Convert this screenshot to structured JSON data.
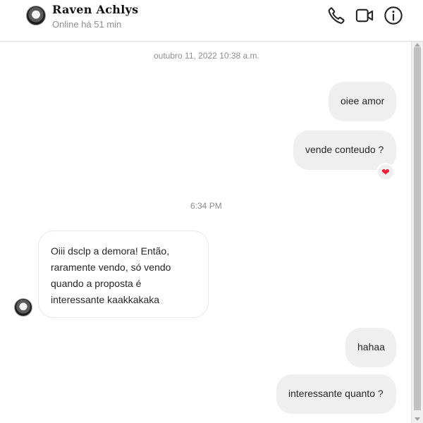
{
  "header": {
    "contact_name": "Raven Achlys",
    "status": "Online há 51 min",
    "icons": [
      "phone-icon",
      "video-camera-icon",
      "info-icon"
    ]
  },
  "chat": {
    "timestamps": [
      "outubro 11, 2022 10:38 a.m.",
      "6:34 PM"
    ],
    "messages": [
      {
        "direction": "outgoing",
        "text": "oiee amor"
      },
      {
        "direction": "outgoing",
        "text": "vende conteudo ?",
        "reaction": "❤"
      },
      {
        "direction": "incoming",
        "lines": [
          "Oiii dsclp a demora! Então,",
          "raramente vendo, só vendo",
          "quando a proposta é",
          "interessante kaakkakaka"
        ]
      },
      {
        "direction": "outgoing",
        "text": "hahaa"
      },
      {
        "direction": "outgoing",
        "text": "interessante quanto ?"
      }
    ]
  },
  "colors": {
    "heart": "#ed1c3a",
    "outgoing_bubble": "#efefef",
    "muted_text": "#8e8e8e"
  }
}
